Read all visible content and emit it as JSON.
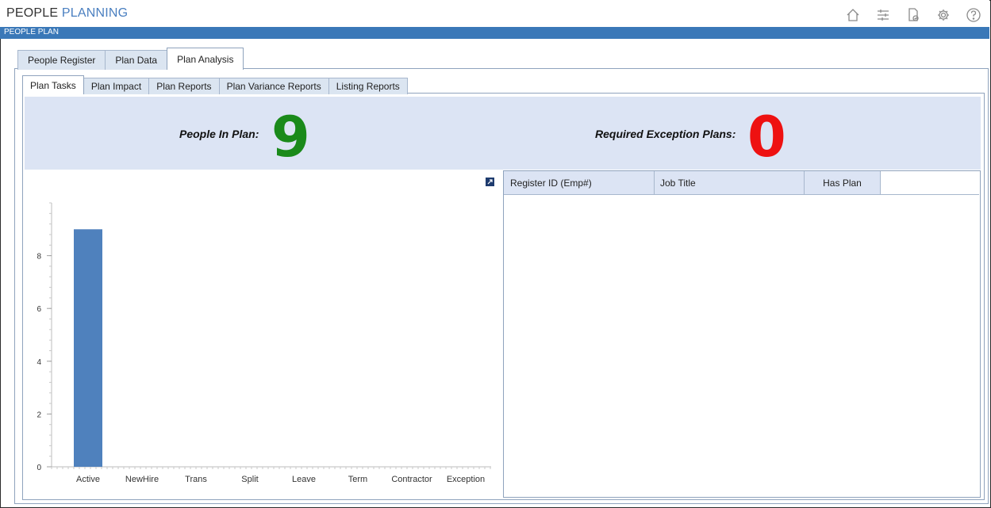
{
  "app": {
    "title_part1": "PEOPLE",
    "title_part2": "PLANNING",
    "section_title": "PEOPLE PLAN",
    "accent_color": "#3a78b8"
  },
  "toolbar": {
    "icons": [
      "home-icon",
      "sliders-icon",
      "document-check-icon",
      "settings-icon",
      "help-icon"
    ]
  },
  "outer_tabs": [
    "People Register",
    "Plan Data",
    "Plan Analysis"
  ],
  "outer_active": "Plan Analysis",
  "inner_tabs": [
    "Plan Tasks",
    "Plan Impact",
    "Plan Reports",
    "Plan Variance Reports",
    "Listing Reports"
  ],
  "inner_active": "Plan Tasks",
  "stats": {
    "people_label": "People In Plan:",
    "people_value": "9",
    "people_color": "#1a8a1a",
    "exception_label": "Required Exception Plans:",
    "exception_value": "0",
    "exception_color": "#ee1111"
  },
  "grid": {
    "columns": [
      "Register ID (Emp#)",
      "Job Title",
      "Has Plan"
    ],
    "rows": []
  },
  "chart_data": {
    "type": "bar",
    "categories": [
      "Active",
      "NewHire",
      "Trans",
      "Split",
      "Leave",
      "Term",
      "Contractor",
      "Exception"
    ],
    "values": [
      9,
      0,
      0,
      0,
      0,
      0,
      0,
      0
    ],
    "ylim": [
      0,
      10
    ],
    "yticks": [
      0,
      2,
      4,
      6,
      8
    ],
    "bar_color": "#4f81bd",
    "grid": false,
    "legend": "none",
    "title": "",
    "xlabel": "",
    "ylabel": ""
  }
}
